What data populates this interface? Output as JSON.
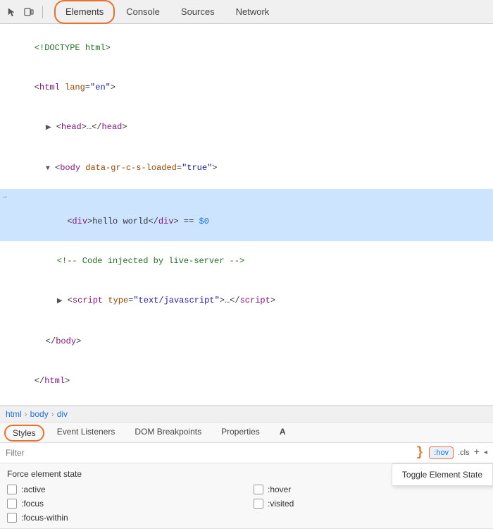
{
  "tabs": {
    "toolbar_icons": [
      "cursor-icon",
      "device-icon"
    ],
    "items": [
      {
        "label": "Elements",
        "active": true
      },
      {
        "label": "Console",
        "active": false
      },
      {
        "label": "Sources",
        "active": false
      },
      {
        "label": "Network",
        "active": false
      }
    ]
  },
  "html_tree": {
    "lines": [
      {
        "indent": 0,
        "content": "<!DOCTYPE html>",
        "type": "doctype"
      },
      {
        "indent": 0,
        "content_html": "&lt;<span class='tag'>html</span> <span class='attr-name'>lang</span>=<span class='attr-value'>\"en\"</span>&gt;",
        "type": "tag"
      },
      {
        "indent": 1,
        "content_html": "&#9658;&nbsp;&lt;<span class='tag'>head</span>&gt;…&lt;/<span class='tag'>head</span>&gt;",
        "type": "tag"
      },
      {
        "indent": 1,
        "content_html": "&#9660;&nbsp;&lt;<span class='tag'>body</span> <span class='attr-name'>data-gr-c-s-loaded</span>=<span class='attr-value'>\"true\"</span>&gt;",
        "type": "tag"
      },
      {
        "indent": 2,
        "content_html": "&lt;<span class='tag'>div</span>&gt;hello world&lt;/<span class='tag'>div</span>&gt;&nbsp;== <span class='dollar'>$0</span>",
        "type": "selected"
      },
      {
        "indent": 2,
        "content_html": "<span class='comment'>&lt;!-- Code injected by live-server --&gt;</span>",
        "type": "comment"
      },
      {
        "indent": 2,
        "content_html": "&#9658;&nbsp;&lt;<span class='tag'>script</span> <span class='attr-name'>type</span>=<span class='attr-value'>\"text/javascript\"</span>&gt;…&lt;/<span class='tag'>script</span>&gt;",
        "type": "tag"
      },
      {
        "indent": 1,
        "content_html": "&lt;/<span class='tag'>body</span>&gt;",
        "type": "tag"
      },
      {
        "indent": 0,
        "content_html": "&lt;/<span class='tag'>html</span>&gt;",
        "type": "tag"
      }
    ]
  },
  "breadcrumb": {
    "items": [
      "html",
      "body",
      "div"
    ]
  },
  "styles_tabs": {
    "items": [
      {
        "label": "Styles",
        "active": true,
        "circled": true
      },
      {
        "label": "Event Listeners",
        "active": false
      },
      {
        "label": "DOM Breakpoints",
        "active": false
      },
      {
        "label": "Properties",
        "active": false
      },
      {
        "label": "A",
        "active": false
      }
    ]
  },
  "filter": {
    "placeholder": "Filter",
    "hov_label": ":hov",
    "cls_label": ".cls",
    "plus_label": "+"
  },
  "force_state": {
    "title": "Force element state",
    "states": [
      {
        "label": ":active",
        "checked": false
      },
      {
        "label": ":hover",
        "checked": false
      },
      {
        "label": ":focus",
        "checked": false
      },
      {
        "label": ":visited",
        "checked": false
      },
      {
        "label": ":focus-within",
        "checked": false
      }
    ]
  },
  "tooltip": {
    "label": "Toggle Element State"
  },
  "three_symbol": "}"
}
